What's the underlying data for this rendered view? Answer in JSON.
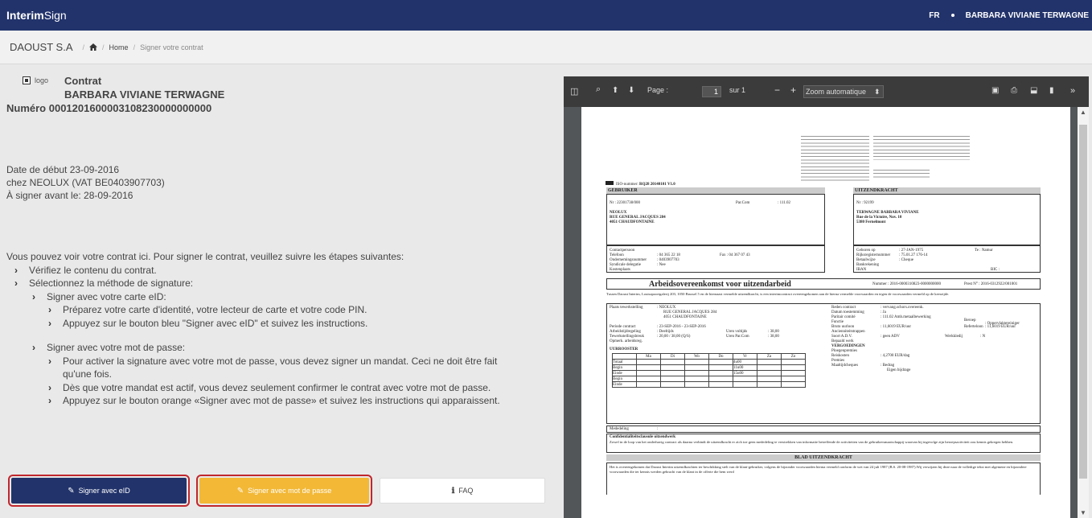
{
  "app": {
    "brand_bold": "Interim",
    "brand_rest": "Sign",
    "lang": "FR",
    "user": "BARBARA VIVIANE TERWAGNE"
  },
  "breadcrumb": {
    "company": "DAOUST S.A",
    "home": "Home",
    "current": "Signer votre contrat"
  },
  "contract": {
    "logo_label": "logo",
    "title": "Contrat",
    "name": "BARBARA VIVIANE TERWAGNE",
    "number": "Numéro 0001201600003108230000000000",
    "start": "Date de début 23-09-2016",
    "at": "chez NEOLUX (VAT BE0403907703)",
    "deadline": "À signer avant le: 28-09-2016"
  },
  "instructions": {
    "intro": "Vous pouvez voir votre contrat ici. Pour signer le contrat, veuillez suivre les étapes suivantes:",
    "step1": "Vérifiez le contenu du contrat.",
    "step2": "Sélectionnez la méthode de signature:",
    "eid_title": "Signer avec votre carte eID:",
    "eid_1": "Préparez votre carte d'identité, votre lecteur de carte et votre code PIN.",
    "eid_2": "Appuyez sur le bouton bleu \"Signer avec eID\" et suivez les instructions.",
    "pw_title": "Signer avec votre mot de passe:",
    "pw_1": "Pour activer la signature avec votre mot de passe, vous devez signer un mandat. Ceci ne doit être fait qu'une fois.",
    "pw_2": "Dès que votre mandat est actif, vous devez seulement confirmer le contrat avec votre mot de passe.",
    "pw_3": "Appuyez sur le bouton orange «Signer avec mot de passe» et suivez les instructions qui apparaissent."
  },
  "buttons": {
    "eid": "Signer avec eID",
    "password": "Signer avec mot de passe",
    "faq": "FAQ"
  },
  "colors": {
    "navy": "#22336b",
    "orange": "#f2b836",
    "highlight": "#c0272d"
  },
  "viewer": {
    "page_label": "Page :",
    "page_value": "1",
    "page_of": "sur 1",
    "zoom": "Zoom automatique",
    "icons": [
      "sidebar-toggle-icon",
      "search-icon",
      "arrow-up-icon",
      "arrow-down-icon",
      "zoom-out-icon",
      "zoom-in-icon",
      "open-file-icon",
      "print-icon",
      "download-icon",
      "bookmark-icon",
      "tools-icon"
    ]
  },
  "pdf": {
    "iso": "ISO-nummer:",
    "iso_value": "RQ28 20140101 V1.0",
    "gebruiker": "GEBRUIKER",
    "uitzendkracht": "UITZENDKRACHT",
    "g_nr": "Nr : 22301738/000",
    "g_parcom": "Par.Com",
    "g_parcom_val": ": 111.02",
    "g_name": "NEOLUX",
    "g_addr1": "RUE GENERAL JACQUES 284",
    "g_addr2": "4051 CHAUDFONTAINE",
    "u_nr": "Nr : 92199",
    "u_name": "TERWAGNE BARBARA VIVIANE",
    "u_addr1": "Rue de la Victoire, Nov. 10",
    "u_addr2": "5380 Fernelmont",
    "g_contact": "Contactpersoon",
    "g_tel": "Telefoon",
    "g_tel_val": ": 04 365 22 18",
    "g_fax": "Fax : 04 367 07 43",
    "g_ondern": "Ondernemingsnummer",
    "g_ondern_val": ": 0403907703",
    "g_synd": "Syndicale delegatie",
    "g_synd_val": ": Nee",
    "g_kost": "Kostenplaats",
    "u_geb": "Geboren op",
    "u_geb_val": ": 27-JAN-1975",
    "u_te": "Te : Namur",
    "u_rijks": "Rijksregisternummer",
    "u_rijks_val": ": 75.01.27 176-14",
    "u_betaal": "Betaalwijze",
    "u_betaal_val": ": Cheque",
    "u_bank": "Bankrekening",
    "u_iban": "IBAN",
    "u_bic": "BIC :",
    "title": "Arbeidsovereenkomst voor uitzendarbeid",
    "nummer": "Nummer : 2016-0000310823-0000000000",
    "prest": "Prest N° : 2016-0312922/001001",
    "intro": "Tussen Daoust Interim, Louisapoortgalerij 203, 1050 Brussel 5 en de hiernaast vermelde uitzendkracht, is een interimcontract overeengekomen aan de hierna vermelde voorwaarden en tegen de voorwaarden vermeld op de keerzijde.",
    "plaats": "Plaats tewerkstelling",
    "plaats_val": ": NEOLUX",
    "plaats_a1": "RUE GENERAL JACQUES 284",
    "plaats_a2": "4051 CHAUDFONTAINE",
    "periode": "Periode contract",
    "periode_val": ": 23-SEP-2016 - 23-SEP-2016",
    "arbeid": "Arbeidstijdregeling",
    "arbeid_val": ": Deeltijds",
    "uren_vol": "Uren voltijds",
    "uren_vol_val": ": 38,00",
    "tewerk": "Tewerkstellingsbreuk",
    "tewerk_val": ": 20,00 / 38,00 (Q/S)",
    "uren_par": "Uren Par.Com",
    "uren_par_val": ": 38,00",
    "opmerk": "Opmerk. arbeidsreg.",
    "uurrooster": "UURROOSTER",
    "days": [
      "Ma",
      "Di",
      "Wo",
      "Do",
      "Vr",
      "Za",
      "Zo"
    ],
    "rows": [
      "Totaal",
      "Begin",
      "Einde",
      "Begin",
      "Einde"
    ],
    "vr_vals": [
      "4u00",
      "11u00",
      "15u00"
    ],
    "reden": "Reden contract",
    "reden_val": ": vervang.schors.overeenk.",
    "datum": "Datum toestemming",
    "datum_val": ": Ja",
    "paritair": "Paritair comité",
    "paritair_val": ": 111.02 Amb.metaalbewerking",
    "functie": "Functie",
    "beroep": "Beroep",
    "beroep_val": ": Oppervlaktereiniger",
    "bruto": "Bruto uurloon",
    "bruto_val": ": 11,6019 EUR/uur",
    "referte": "Referteloon",
    "referte_val": ": 11,6019 EUR/uur",
    "ancien": "Ancienniteitstrappen",
    "soort": "Soort A.D.V.",
    "soort_val": ": geen ADV",
    "werkkledij": "Werkkledij",
    "werkkledij_val": ": N",
    "bepaald": "Bepaald werk",
    "vergoed": "VERGOEDINGEN",
    "ploeg": "Ploegenpremies",
    "reis": "Reiskosten",
    "reis_val": ": 4,2700 EUR/dag",
    "premies": "Premies",
    "maaltijd": "Maaltijdcheques",
    "bedrag": ": Bedrag",
    "eigen": "Eigen bijdrage",
    "mededeling": "Mededeling",
    "conf": "Confidentialiteitsclausule uitzendwerk",
    "conf_text": "Zowel in de loop van het onderhavig contract als daarna verbindt de uitzendkracht er zich toe geen mededeling te verstrekken van informatie betreffende de activiteiten van de gebruikersmaatschappij waarvan hij ingevolge zijn beroepsactiviteit zou kennis gekregen hebben.",
    "blad": "BLAD UITZENDKRACHT",
    "bottom": "Het is overeengekomen dat Daoust Interim uitzendkrachten ter beschikking stelt van de klant-gebruiker, volgens de bijzonder voorwaarden hierna vermeld conform de wet van 24 juli 1987 (B.S. 20-08-1987).Wij verwijzen bij deze naar de volledige tekst met algemene en bijzondere voorwaarden die ter kennis werden gebracht van de klant in de offerte die hem werd"
  }
}
